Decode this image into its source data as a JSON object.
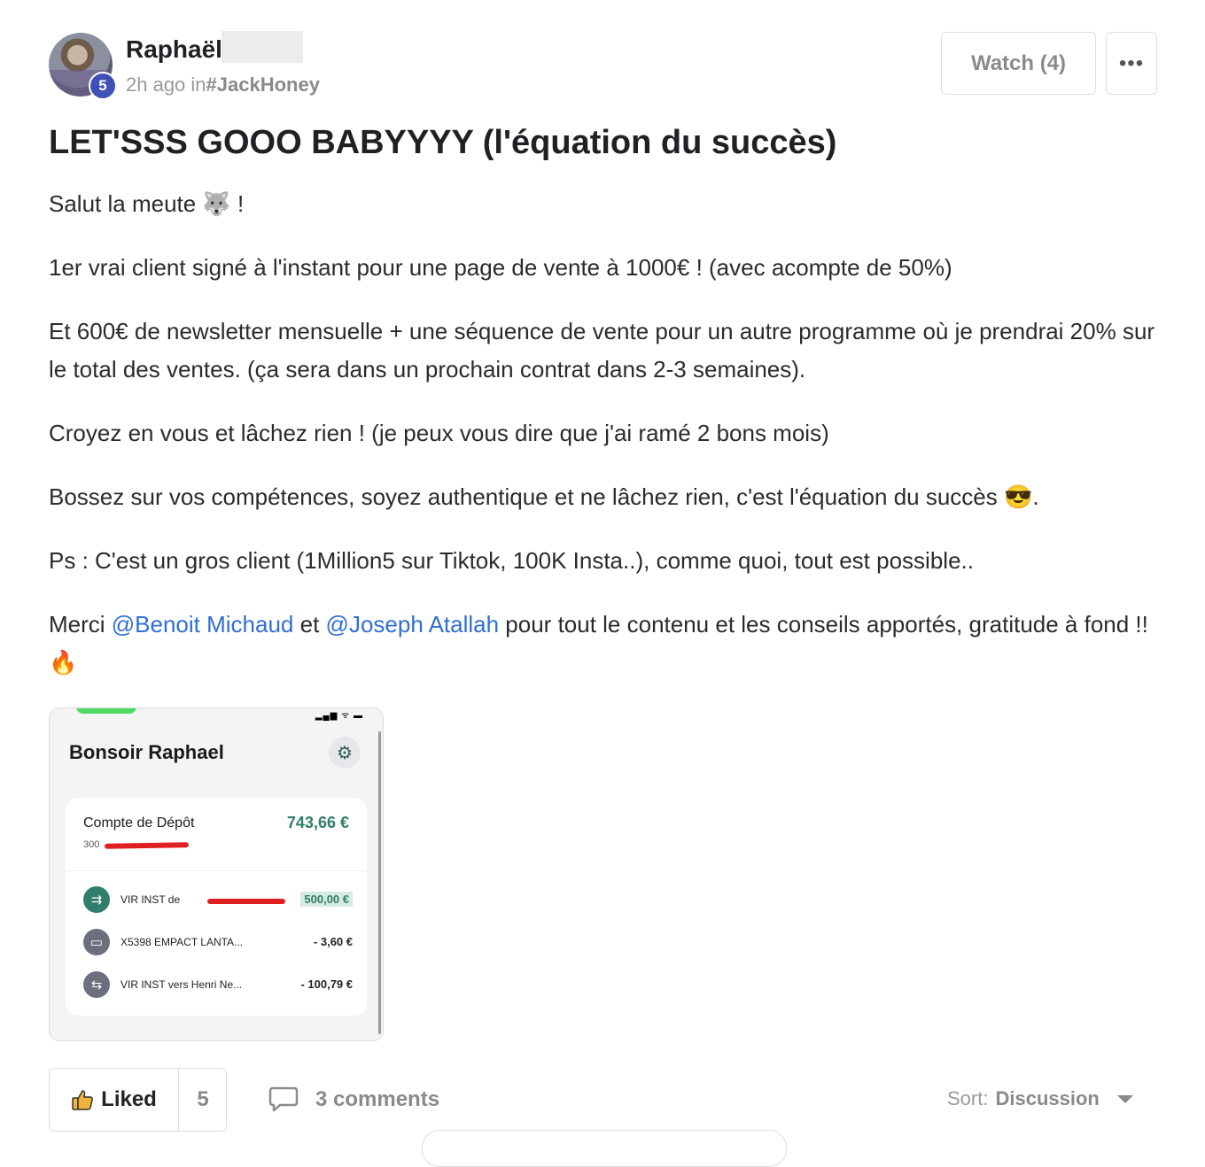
{
  "author": {
    "name": "Raphaël",
    "level": "5",
    "time_ago": "2h ago",
    "in_word": "in",
    "group": "#JackHoney"
  },
  "actions": {
    "watch_label": "Watch (4)",
    "more_label": "•••"
  },
  "post": {
    "title": "LET'SSS GOOO BABYYYY (l'équation du succès)",
    "p1": "Salut la meute 🐺 !",
    "p2": "1er vrai client signé à l'instant pour une page de vente à 1000€ ! (avec acompte de 50%)",
    "p3": "Et 600€ de newsletter mensuelle + une séquence de vente pour un autre programme où je prendrai 20% sur le total des ventes. (ça sera dans un prochain contrat dans 2-3 semaines).",
    "p4": "Croyez en vous et lâchez rien ! (je peux vous dire que j'ai ramé 2 bons mois)",
    "p5": "Bossez sur vos compétences, soyez authentique et ne lâchez rien, c'est l'équation du succès 😎.",
    "p6": "Ps : C'est un gros client (1Million5 sur Tiktok, 100K Insta..), comme quoi, tout est possible..",
    "p7_start": "Merci ",
    "mention1": "@Benoit Michaud",
    "p7_mid": " et ",
    "mention2": "@Joseph Atallah",
    "p7_end": " pour tout le contenu et les conseils apportés, gratitude à fond !! 🔥"
  },
  "screenshot": {
    "status_icons": "▂▄▆ ᯤ ▬",
    "greeting": "Bonsoir Raphael",
    "account_name": "Compte de Dépôt",
    "account_balance": "743,66 €",
    "account_number": "300",
    "transactions": [
      {
        "label": "VIR INST de",
        "amount": "500,00 €",
        "icon": "⇉"
      },
      {
        "label": "X5398 EMPACT LANTA...",
        "amount": "- 3,60 €",
        "icon": "▭"
      },
      {
        "label": "VIR INST vers Henri Ne...",
        "amount": "- 100,79 €",
        "icon": "⇆"
      }
    ]
  },
  "footer": {
    "liked_label": "Liked",
    "like_count": "5",
    "comments_label": "3 comments",
    "sort_prefix": "Sort:",
    "sort_value": "Discussion"
  },
  "colors": {
    "mention": "#2f6fd6",
    "badge": "#3f51b5",
    "bank_green": "#2f7d6a"
  }
}
